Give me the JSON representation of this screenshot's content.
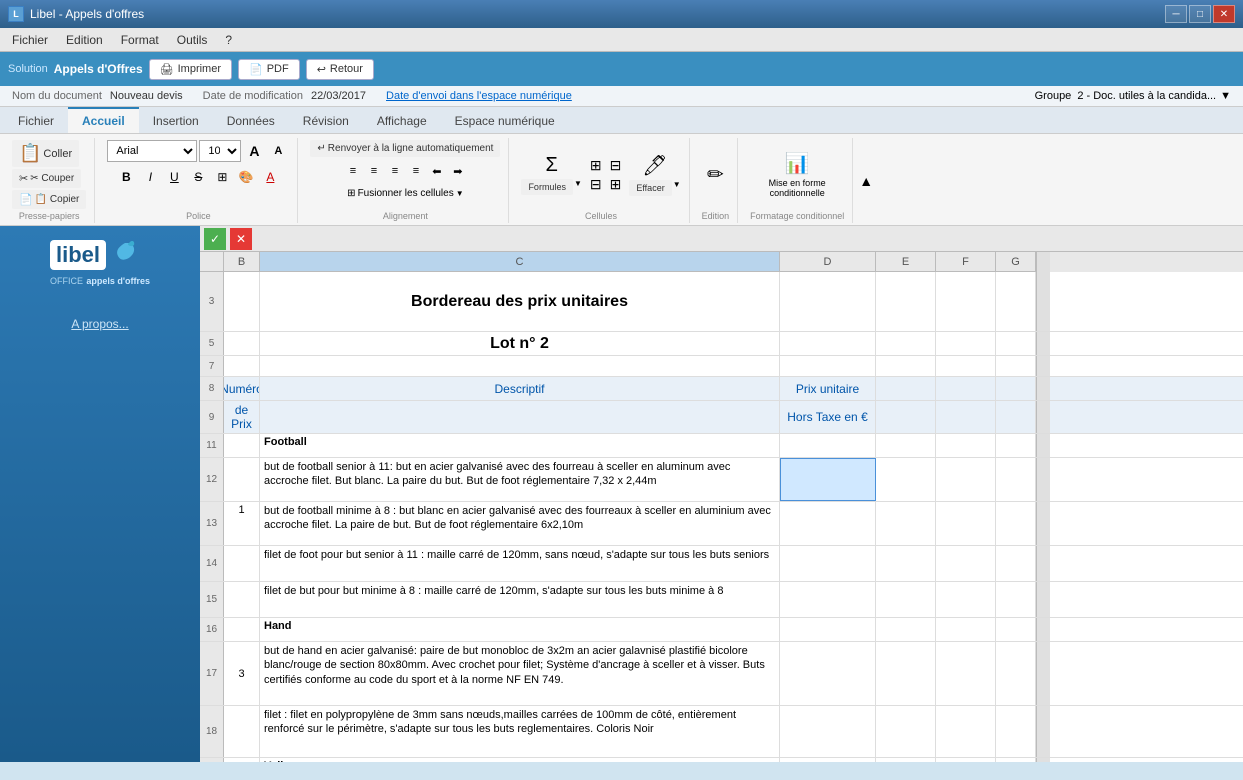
{
  "titlebar": {
    "title": "Libel - Appels d'offres",
    "controls": [
      "minimize",
      "maximize",
      "close"
    ]
  },
  "menubar": {
    "items": [
      "Fichier",
      "Edition",
      "Format",
      "Outils",
      "?"
    ]
  },
  "toolbar": {
    "solution_label": "Solution",
    "solution_name": "Appels d'Offres",
    "buttons": [
      {
        "id": "imprimer",
        "label": "Imprimer",
        "icon": "🖨"
      },
      {
        "id": "pdf",
        "label": "PDF",
        "icon": "📄"
      },
      {
        "id": "retour",
        "label": "Retour",
        "icon": "↩"
      }
    ]
  },
  "docinfo": {
    "nom_label": "Nom du document",
    "nom_value": "Nouveau devis",
    "date_modif_label": "Date de modification",
    "date_modif_value": "22/03/2017",
    "date_envoi_label": "Date d'envoi dans l'espace numérique",
    "groupe_label": "Groupe",
    "groupe_value": "2 - Doc. utiles à la candida..."
  },
  "ribbon": {
    "tabs": [
      "Fichier",
      "Accueil",
      "Insertion",
      "Données",
      "Révision",
      "Affichage",
      "Espace numérique"
    ],
    "active_tab": "Accueil",
    "groups": {
      "presse_papiers": {
        "label": "Presse-papiers",
        "coller": "Coller",
        "couper": "✂ Couper",
        "copier": "📋 Copier"
      },
      "police": {
        "label": "Police",
        "font": "Arial",
        "size": "10"
      },
      "alignement": {
        "label": "Alignement",
        "renvoyer": "Renvoyer à la ligne automatiquement",
        "fusionner": "Fusionner les cellules"
      },
      "cellules": {
        "label": "Cellules",
        "formules": "Formules",
        "effacer": "Effacer"
      },
      "edition": {
        "label": "Edition"
      },
      "formatage": {
        "label": "Formatage conditionnel",
        "mise_en_forme": "Mise en forme conditionnelle"
      }
    }
  },
  "sidebar": {
    "logo": "libel",
    "tagline": "OFFICE appels d'offres",
    "about": "A propos..."
  },
  "spreadsheet": {
    "columns": [
      "B",
      "C",
      "D",
      "E",
      "F",
      "G"
    ],
    "rows": [
      {
        "num": "3",
        "cells": {
          "c": "",
          "d": "",
          "e": "",
          "f": ""
        },
        "height": "h50"
      },
      {
        "num": "5",
        "cells": {
          "c": "Lot n° 2",
          "d": "",
          "e": "",
          "f": ""
        },
        "height": "h24"
      },
      {
        "num": "7",
        "cells": {
          "c": "",
          "d": "",
          "e": "",
          "f": ""
        },
        "height": "h20"
      },
      {
        "num": "8",
        "cells": {
          "b": "Numéro",
          "c": "Descriptif",
          "d": "Prix unitaire",
          "e": "",
          "f": ""
        },
        "height": "h24",
        "is_header": true
      },
      {
        "num": "9",
        "cells": {
          "b": "de Prix",
          "c": "",
          "d": "Hors Taxe en €",
          "e": "",
          "f": ""
        },
        "height": "h24",
        "is_header": true
      },
      {
        "num": "11",
        "cells": {
          "b": "",
          "c": "Football",
          "d": "",
          "e": "",
          "f": ""
        },
        "height": "h24",
        "bold_c": true
      },
      {
        "num": "12",
        "cells": {
          "b": "",
          "c": "but de football senior à 11: but en acier galvanisé avec des fourreau à sceller en aluminum avec accroche filet. But blanc. La paire du but. But de foot réglementaire 7,32 x 2,44m",
          "d": "",
          "e": "",
          "f": ""
        },
        "height": "h48",
        "has_price": true
      },
      {
        "num": "13",
        "cells": {
          "b": "1",
          "c": "but de football minime à 8 : but blanc en acier galvanisé avec des fourreaux à sceller en aluminium avec accroche filet. La paire de but. But de foot réglementaire 6x2,10m",
          "d": "",
          "e": "",
          "f": ""
        },
        "height": "h44"
      },
      {
        "num": "14",
        "cells": {
          "b": "",
          "c": "filet de foot pour but senior à 11 : maille carré de 120mm, sans nœud, s'adapte sur tous les buts seniors",
          "d": "",
          "e": "",
          "f": ""
        },
        "height": "h36"
      },
      {
        "num": "15",
        "cells": {
          "b": "",
          "c": "filet de but pour but minime à 8 : maille carré de 120mm, s'adapte sur tous les buts minime à 8",
          "d": "",
          "e": "",
          "f": ""
        },
        "height": "h36"
      },
      {
        "num": "16",
        "cells": {
          "b": "",
          "c": "Hand",
          "d": "",
          "e": "",
          "f": ""
        },
        "height": "h24",
        "bold_c": true
      },
      {
        "num": "17",
        "cells": {
          "b": "3",
          "c": "but de hand en acier galvanisé: paire de but monobloc de 3x2m an acier galavnisé plastifié bicolore blanc/rouge de section 80x80mm. Avec crochet pour filet; Système d'ancrage à sceller et à visser. Buts certifiés conforme au code du sport et à la norme NF EN 749.",
          "d": "",
          "e": "",
          "f": ""
        },
        "height": "h60"
      },
      {
        "num": "18",
        "cells": {
          "b": "",
          "c": "filet : filet en polypropylène de 3mm sans nœuds,mailles carrées de 100mm de côté, entièrement renforcé sur le périmètre, s'adapte sur tous les buts reglementaires. Coloris Noir",
          "d": "",
          "e": "",
          "f": ""
        },
        "height": "h50"
      },
      {
        "num": "19",
        "cells": {
          "b": "",
          "c": "Volley",
          "d": "",
          "e": "",
          "f": ""
        },
        "height": "h24",
        "bold_c": true
      }
    ],
    "title_row": "Bordereau des prix unitaires"
  }
}
